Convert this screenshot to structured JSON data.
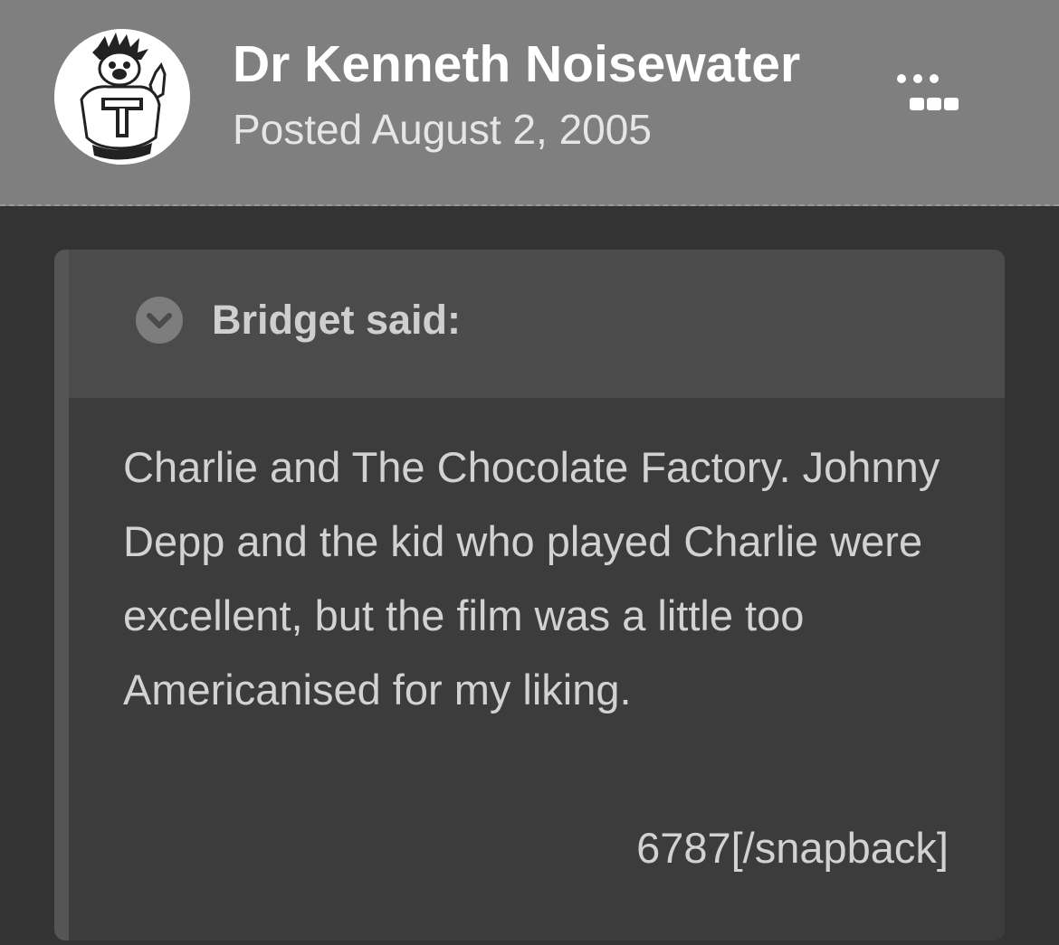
{
  "post": {
    "author_name": "Dr Kenneth Noisewater",
    "posted_label": "Posted August 2, 2005",
    "avatar_icon": "cartoon-avatar-icon",
    "menu_icon": "more-options-icon"
  },
  "quote": {
    "author_label": "Bridget said:",
    "toggle_icon": "chevron-down-icon",
    "body": "Charlie and The Chocolate Factory. Johnny Depp and the kid who played Charlie were excellent, but the film was a little too Americanised for my liking.",
    "snapback_text": "6787[/snapback]"
  },
  "colors": {
    "header_bg": "#7f7f7f",
    "page_bg": "#333333",
    "quote_bg": "#3c3c3c",
    "quote_head_bg": "#4b4b4b"
  }
}
